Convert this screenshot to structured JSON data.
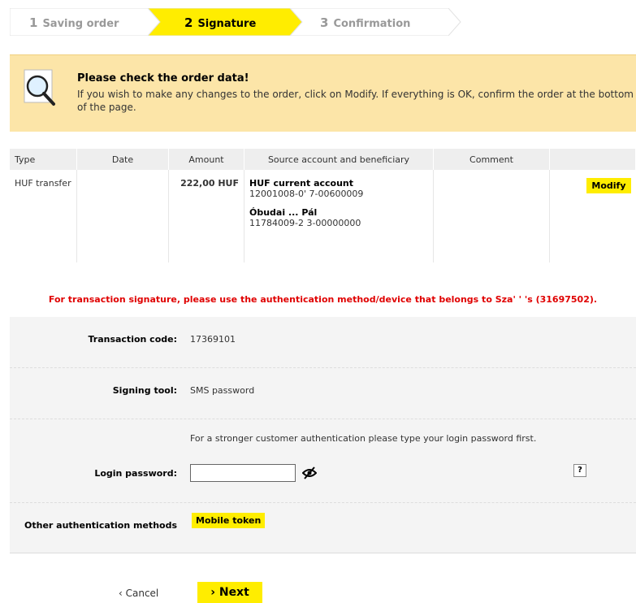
{
  "steps": [
    {
      "num": "1",
      "label": "Saving order",
      "active": false
    },
    {
      "num": "2",
      "label": "Signature",
      "active": true
    },
    {
      "num": "3",
      "label": "Confirmation",
      "active": false
    }
  ],
  "banner": {
    "icon": "magnifier-icon",
    "title": "Please check the order data!",
    "text": "If you wish to make any changes to the order, click on Modify. If everything is OK, confirm the order at the bottom of the page."
  },
  "table": {
    "headers": [
      "Type",
      "Date",
      "Amount",
      "Source account and beneficiary",
      "Comment",
      ""
    ],
    "row": {
      "type": "HUF transfer",
      "date": "",
      "amount": "222,00 HUF",
      "source_name": "HUF current account",
      "source_account": "12001008-0' 7-00600009",
      "beneficiary_name": "Óbudai ... Pál",
      "beneficiary_account": "11784009-2 3-00000000",
      "comment": "",
      "modify_label": "Modify"
    }
  },
  "warning": "For transaction signature, please use the authentication method/device that belongs to Sza' ' 's (31697502).",
  "form": {
    "transaction_code_label": "Transaction code:",
    "transaction_code": "17369101",
    "signing_tool_label": "Signing tool:",
    "signing_tool": "SMS password",
    "password_hint": "For a stronger customer authentication please type your login password first.",
    "login_password_label": "Login password:",
    "login_password_value": "",
    "help_label": "?",
    "other_methods_label": "Other authentication methods",
    "mobile_token_label": "Mobile token"
  },
  "footer": {
    "cancel_label": "‹ Cancel",
    "next_label": "› Next"
  },
  "colors": {
    "accent": "#ffed00",
    "banner": "#fce5a8",
    "warning": "#e00000"
  }
}
